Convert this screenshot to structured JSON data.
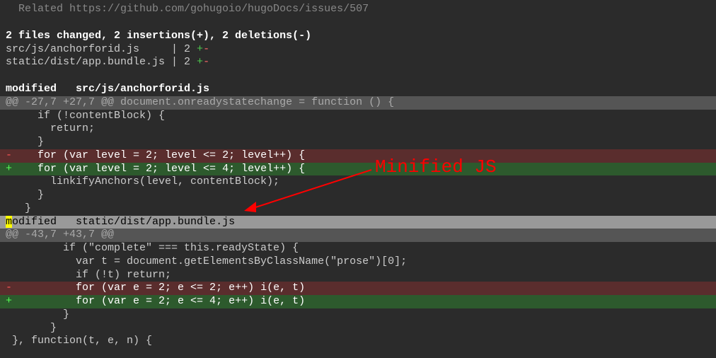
{
  "top_line": "  Related https://github.com/gohugoio/hugoDocs/issues/507",
  "blank": " ",
  "summary": "2 files changed, 2 insertions(+), 2 deletions(-)",
  "filestat1_pre": "src/js/anchorforid.js     | 2 ",
  "filestat1_plus": "+",
  "filestat1_minus": "-",
  "filestat2_pre": "static/dist/app.bundle.js | 2 ",
  "filestat2_plus": "+",
  "filestat2_minus": "-",
  "modified1": "modified   src/js/anchorforid.js",
  "hunk1": "@@ -27,7 +27,7 @@ document.onreadystatechange = function () {",
  "ctx1_1": "     if (!contentBlock) {",
  "ctx1_2": "       return;",
  "ctx1_3": "     }",
  "rem1_marker": "-",
  "rem1_body": "    for (var level = 2; level <= 2; level++) {",
  "add1_marker": "+",
  "add1_body": "    for (var level = 2; level <= 4; level++) {",
  "ctx1_4": "       linkifyAnchors(level, contentBlock);",
  "ctx1_5": "     }",
  "ctx1_6": "   }",
  "modified2_m": "m",
  "modified2_rest": "odified   static/dist/app.bundle.js",
  "hunk2": "@@ -43,7 +43,7 @@",
  "ctx2_1": "         if (\"complete\" === this.readyState) {",
  "ctx2_2": "           var t = document.getElementsByClassName(\"prose\")[0];",
  "ctx2_3": "           if (!t) return;",
  "rem2_marker": "-",
  "rem2_body": "          for (var e = 2; e <= 2; e++) i(e, t)",
  "add2_marker": "+",
  "add2_body": "          for (var e = 2; e <= 4; e++) i(e, t)",
  "ctx2_4": "         }",
  "ctx2_5": "       }",
  "ctx2_6": " }, function(t, e, n) {",
  "annotation": "Minified JS"
}
